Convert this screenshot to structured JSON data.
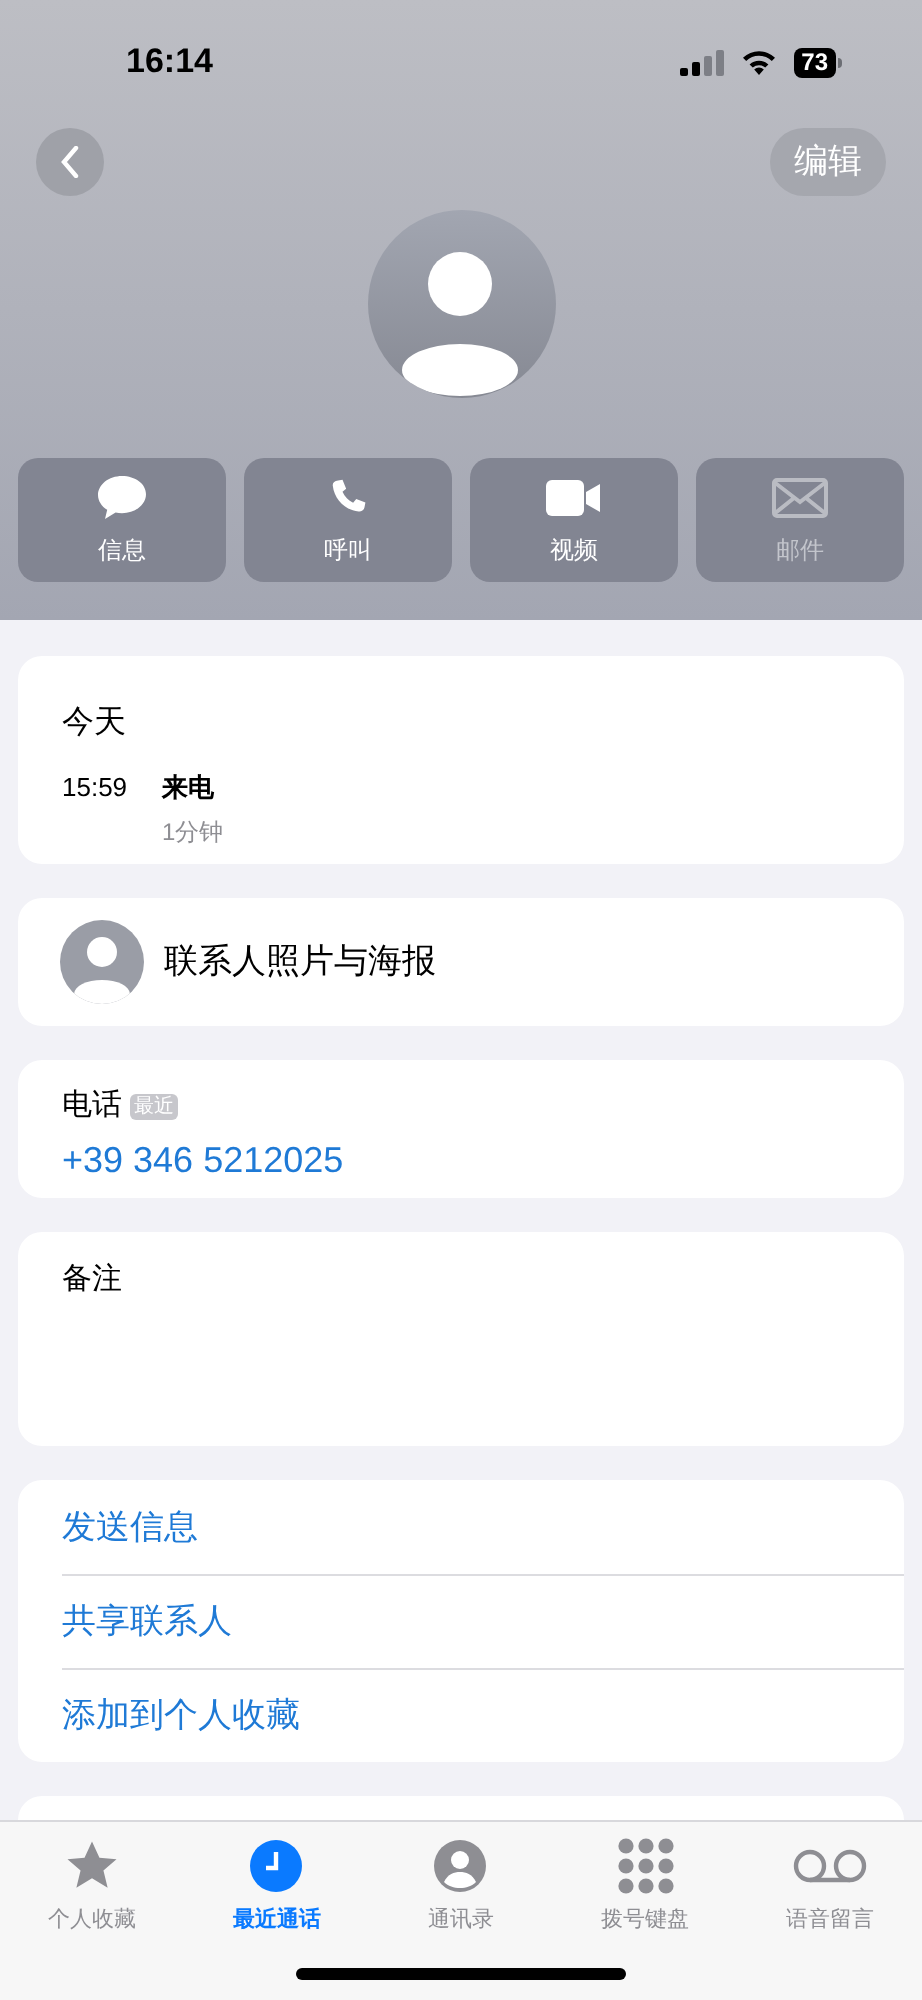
{
  "status_bar": {
    "time": "16:14",
    "battery": "73"
  },
  "header": {
    "edit_button": "编辑"
  },
  "actions": [
    {
      "kind": "message",
      "label": "信息",
      "disabled": false
    },
    {
      "kind": "call",
      "label": "呼叫",
      "disabled": false
    },
    {
      "kind": "video",
      "label": "视频",
      "disabled": false
    },
    {
      "kind": "mail",
      "label": "邮件",
      "disabled": true
    }
  ],
  "call_history": {
    "title": "今天",
    "entries": [
      {
        "time": "15:59",
        "type": "来电",
        "duration": "1分钟"
      }
    ]
  },
  "contact_poster": {
    "label": "联系人照片与海报"
  },
  "phone": {
    "label": "电话",
    "badge": "最近",
    "number": "+39 346 5212025"
  },
  "notes": {
    "label": "备注"
  },
  "links": [
    "发送信息",
    "共享联系人",
    "添加到个人收藏"
  ],
  "tab_bar": [
    {
      "kind": "star",
      "label": "个人收藏",
      "selected": false
    },
    {
      "kind": "clock",
      "label": "最近通话",
      "selected": true
    },
    {
      "kind": "person",
      "label": "通讯录",
      "selected": false
    },
    {
      "kind": "keypad",
      "label": "拨号键盘",
      "selected": false
    },
    {
      "kind": "voicemail",
      "label": "语音留言",
      "selected": false
    }
  ]
}
